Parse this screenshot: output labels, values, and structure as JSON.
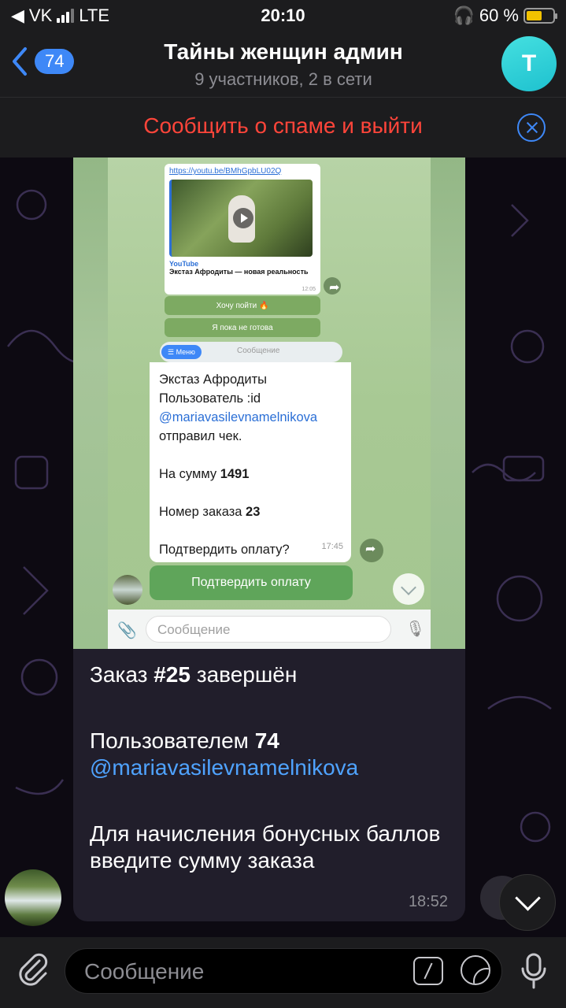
{
  "status_bar": {
    "back_app": "VK",
    "network": "LTE",
    "time": "20:10",
    "battery_text": "60 %",
    "battery_level": 0.6
  },
  "header": {
    "back_badge": "74",
    "title": "Тайны женщин админ",
    "subtitle": "9 участников, 2 в сети",
    "avatar_letter": "T"
  },
  "spam_bar": {
    "text": "Сообщить о спаме и выйти"
  },
  "screenshot": {
    "yt_link": "https://youtu.be/BMhGpbLU02Q",
    "yt_source": "YouTube",
    "yt_title": "Экстаз Афродиты — новая реальность",
    "yt_time": "12:05",
    "btn_go": "Хочу пойти 🔥",
    "btn_not_ready": "Я пока не готова",
    "menu_label": "☰ Меню",
    "mini_placeholder": "Сообщение",
    "receipt": {
      "line1": "Экстаз Афродиты",
      "line2": "Пользователь :id",
      "mention": "@mariavasilevnamelnikova",
      "line3": "отправил чек.",
      "sum_label": "На сумму ",
      "sum_value": "1491",
      "order_label": "Номер заказа ",
      "order_value": "23",
      "question": "Подтвердить оплату?",
      "time": "17:45"
    },
    "confirm_button": "Подтвердить оплату",
    "input_placeholder": "Сообщение"
  },
  "caption": {
    "order_prefix": "Заказ ",
    "order_number": "#25",
    "order_suffix": " завершён",
    "user_prefix": "Пользователем ",
    "user_id": "74",
    "mention": "@mariavasilevnamelnikova",
    "bonus_text": "Для начисления бонусных баллов введите сумму заказа",
    "time": "18:52"
  },
  "input_bar": {
    "placeholder": "Сообщение"
  },
  "colors": {
    "accent": "#3e88f7",
    "spam_red": "#ff453a",
    "bubble": "#211e2b",
    "bar_bg": "#1c1c1e"
  }
}
